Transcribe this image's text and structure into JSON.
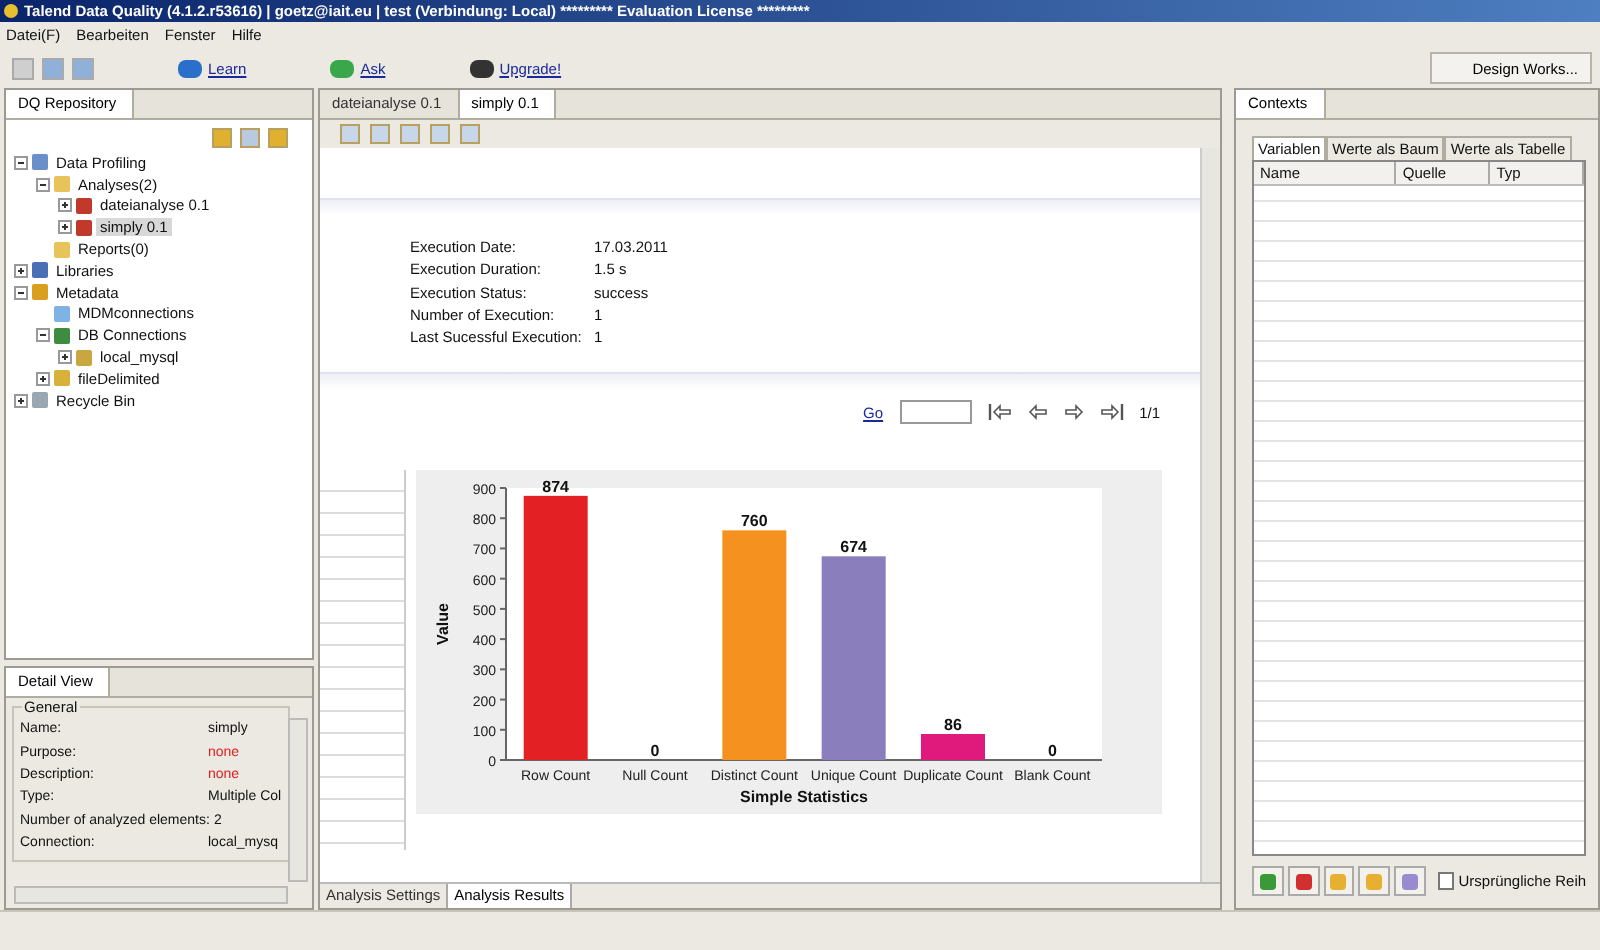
{
  "window": {
    "title": "Talend Data Quality (4.1.2.r53616) | goetz@iait.eu | test (Verbindung: Local) ********* Evaluation License *********"
  },
  "menu": [
    "Datei(F)",
    "Bearbeiten",
    "Fenster",
    "Hilfe"
  ],
  "toolbar": {
    "links": [
      {
        "label": "Learn",
        "kind": "learn"
      },
      {
        "label": "Ask",
        "kind": "ask"
      },
      {
        "label": "Upgrade!",
        "kind": "upgrade"
      }
    ],
    "perspective": "Design Works..."
  },
  "repository": {
    "title": "DQ Repository",
    "tree": [
      {
        "label": "Data Profiling",
        "kind": "profiling",
        "selected": false,
        "expanded": true,
        "children": [
          {
            "label": "Analyses(2)",
            "kind": "folder",
            "selected": false,
            "expanded": true,
            "children": [
              {
                "label": "dateianalyse 0.1",
                "kind": "analysis",
                "selected": false,
                "expanded": false
              },
              {
                "label": "simply 0.1",
                "kind": "analysis",
                "selected": true,
                "expanded": false
              }
            ]
          },
          {
            "label": "Reports(0)",
            "kind": "folder",
            "selected": false
          }
        ]
      },
      {
        "label": "Libraries",
        "kind": "library",
        "selected": false,
        "expanded": false
      },
      {
        "label": "Metadata",
        "kind": "metadata",
        "selected": false,
        "expanded": true,
        "children": [
          {
            "label": "MDMconnections",
            "kind": "mdm",
            "selected": false
          },
          {
            "label": "DB Connections",
            "kind": "db",
            "selected": false,
            "expanded": true,
            "children": [
              {
                "label": "local_mysql",
                "kind": "connection",
                "selected": false,
                "expanded": false
              }
            ]
          },
          {
            "label": "fileDelimited",
            "kind": "file",
            "selected": false,
            "expanded": false
          }
        ]
      },
      {
        "label": "Recycle Bin",
        "kind": "recycle",
        "selected": false,
        "expanded": false
      }
    ]
  },
  "detail_view": {
    "title": "Detail View",
    "group": "General",
    "fields": [
      {
        "name": "Name:",
        "value": "simply",
        "missing": false
      },
      {
        "name": "Purpose:",
        "value": "none",
        "missing": true
      },
      {
        "name": "Description:",
        "value": "none",
        "missing": true
      },
      {
        "name": "Type:",
        "value": "Multiple Col",
        "missing": false
      },
      {
        "name": "Number of analyzed elements:",
        "value": "2",
        "missing": false
      },
      {
        "name": "Connection:",
        "value": "local_mysq",
        "missing": false
      }
    ]
  },
  "editor": {
    "tabs": [
      {
        "label": "dateianalyse 0.1",
        "selected": false
      },
      {
        "label": "simply 0.1",
        "selected": true
      }
    ],
    "execution": [
      {
        "name": "Execution Date:",
        "value": "17.03.2011"
      },
      {
        "name": "Execution Duration:",
        "value": "1.5 s"
      },
      {
        "name": "Execution Status:",
        "value": "success"
      },
      {
        "name": "Number of Execution:",
        "value": "1"
      },
      {
        "name": "Last Sucessful Execution:",
        "value": "1"
      }
    ],
    "paging": {
      "go": "Go",
      "page": "1/1"
    },
    "chart_data": {
      "type": "bar",
      "xlabel": "Simple Statistics",
      "ylabel": "Value",
      "categories": [
        "Row Count",
        "Null Count",
        "Distinct Count",
        "Unique Count",
        "Duplicate Count",
        "Blank Count"
      ],
      "values": [
        874,
        0,
        760,
        674,
        86,
        0
      ],
      "colors": [
        "#e32124",
        null,
        "#f5921f",
        "#8a7ebd",
        "#e0197c",
        null
      ],
      "ylim": [
        0,
        900
      ],
      "yticks": [
        0,
        100,
        200,
        300,
        400,
        500,
        600,
        700,
        800,
        900
      ],
      "data_labels": true
    },
    "bottom_tabs": [
      {
        "label": "Analysis Settings",
        "selected": false
      },
      {
        "label": "Analysis Results",
        "selected": true
      }
    ]
  },
  "contexts": {
    "title": "Contexts",
    "tabs": [
      {
        "label": "Variablen",
        "selected": true
      },
      {
        "label": "Werte als Baum",
        "selected": false
      },
      {
        "label": "Werte als Tabelle",
        "selected": false
      }
    ],
    "columns": [
      "Name",
      "Quelle",
      "Typ"
    ],
    "buttons": [
      {
        "kind": "add"
      },
      {
        "kind": "remove"
      },
      {
        "kind": "up"
      },
      {
        "kind": "down"
      },
      {
        "kind": "sort"
      }
    ],
    "checkbox": {
      "label": "Ursprüngliche Reih",
      "checked": false
    }
  }
}
